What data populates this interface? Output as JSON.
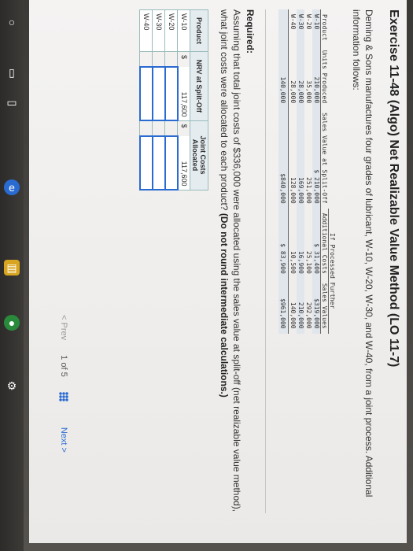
{
  "title": "Exercise 11-48 (Algo) Net Realizable Value Method (LO 11-7)",
  "intro": "Deming & Sons manufactures four grades of lubricant, W-10, W-20, W-30, and W-40, from a joint process. Additional information follows:",
  "data_table": {
    "group_header": "If Processed Further",
    "headers": [
      "Product",
      "Units Produced",
      "Sales Value at Split-Off",
      "Additional Costs",
      "Sales Values"
    ],
    "rows": [
      {
        "product": "W-10",
        "units": "210,000",
        "split_off": "$ 210,000",
        "add_costs": "$ 31,400",
        "sales": "$319,000"
      },
      {
        "product": "W-20",
        "units": "35,000",
        "split_off": "251,000",
        "add_costs": "25,100",
        "sales": "292,000"
      },
      {
        "product": "W-30",
        "units": "28,000",
        "split_off": "169,000",
        "add_costs": "16,900",
        "sales": "210,000"
      },
      {
        "product": "W-40",
        "units": "28,000",
        "split_off": "128,000",
        "add_costs": "10,500",
        "sales": "140,000"
      }
    ],
    "total": {
      "units": "140,000",
      "split_off": "$840,000",
      "add_costs": "$ 83,900",
      "sales": "$961,000"
    }
  },
  "required_label": "Required:",
  "required_text": "Assuming that total joint costs of $336,000 were allocated using the sales value at split-off (net realizable value method), what joint costs were allocated to each product?",
  "required_note": "(Do not round intermediate calculations.)",
  "answer_table": {
    "headers": [
      "Product",
      "NRV at Split-Off",
      "Joint Costs Allocated"
    ],
    "rows": [
      {
        "product": "W-10",
        "nrv_cur": "$",
        "nrv": "117,600",
        "jc_cur": "$",
        "jc": "117,600"
      },
      {
        "product": "W-20",
        "nrv_cur": "",
        "nrv": "",
        "jc_cur": "",
        "jc": ""
      },
      {
        "product": "W-30",
        "nrv_cur": "",
        "nrv": "",
        "jc_cur": "",
        "jc": ""
      },
      {
        "product": "W-40",
        "nrv_cur": "",
        "nrv": "",
        "jc_cur": "",
        "jc": ""
      }
    ]
  },
  "nav": {
    "prev": "< Prev",
    "page": "1 of 5",
    "next": "Next >"
  },
  "colors": {
    "accent": "#2a6bd1",
    "header_bg": "#e4ecef"
  },
  "taskbar_icons": [
    "start-icon",
    "search-icon",
    "task-view-icon",
    "edge-icon",
    "explorer-icon",
    "chrome-icon",
    "settings-icon"
  ]
}
